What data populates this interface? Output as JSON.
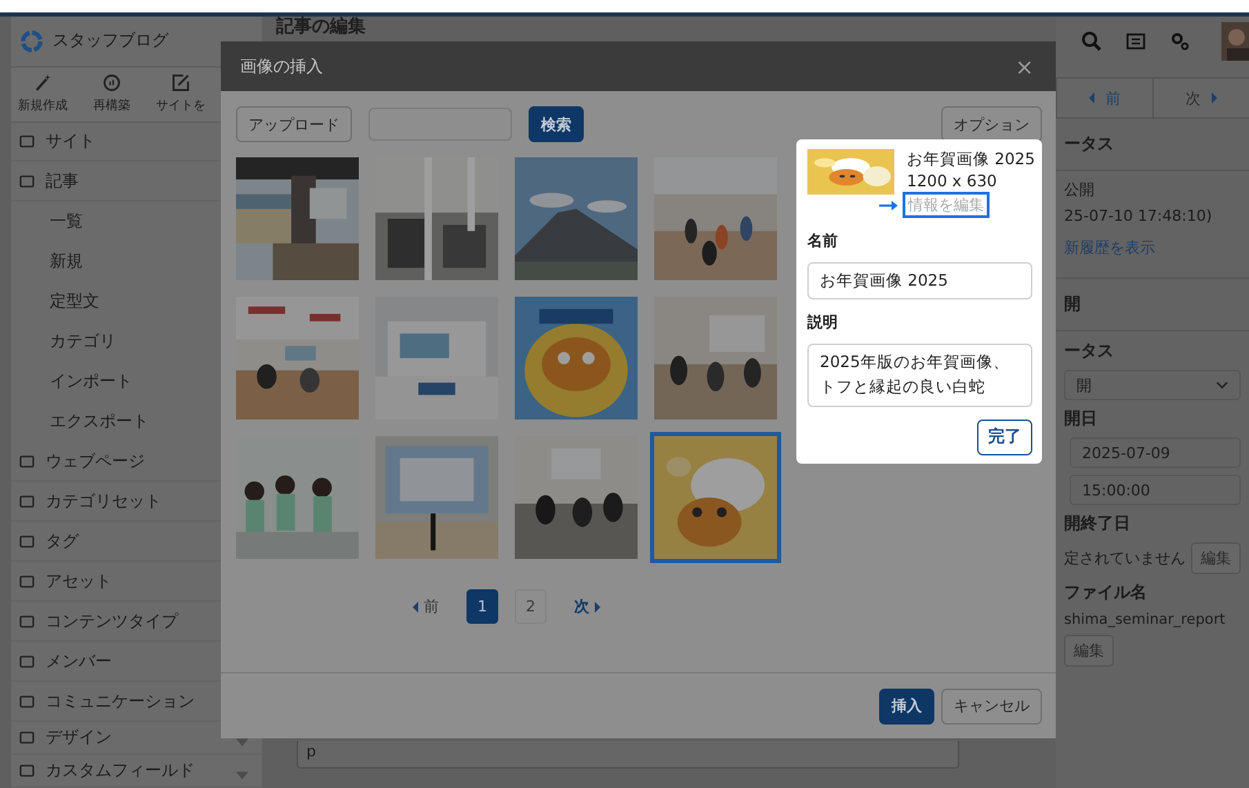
{
  "header_bar": {
    "page_title": "記事の編集"
  },
  "sidebar": {
    "site_name": "スタッフブログ",
    "toolbar": [
      {
        "label": "新規作成"
      },
      {
        "label": "再構築"
      },
      {
        "label": "サイトを"
      }
    ],
    "items": [
      {
        "label": "サイト"
      },
      {
        "label": "記事",
        "children": [
          {
            "label": "一覧"
          },
          {
            "label": "新規"
          },
          {
            "label": "定型文"
          },
          {
            "label": "カテゴリ"
          },
          {
            "label": "インポート"
          },
          {
            "label": "エクスポート"
          }
        ]
      },
      {
        "label": "ウェブページ"
      },
      {
        "label": "カテゴリセット"
      },
      {
        "label": "タグ"
      },
      {
        "label": "アセット"
      },
      {
        "label": "コンテンツタイプ"
      },
      {
        "label": "メンバー"
      },
      {
        "label": "コミュニケーション"
      },
      {
        "label": "デザイン",
        "dropdown": true
      },
      {
        "label": "カスタムフィールド",
        "dropdown": true
      }
    ]
  },
  "editor": {
    "format_field": "p"
  },
  "right_panel": {
    "pager": [
      {
        "label": "前"
      },
      {
        "label": "次"
      }
    ],
    "status_heading": "ータス",
    "status": "公開",
    "updated": "25-07-10 17:48:10)",
    "history_link": "新履歴を表示",
    "section_heading": "開",
    "status_select_heading": "ータス",
    "status_select": "開",
    "publish_date_label": "開日",
    "date": "2025-07-09",
    "time": "15:00:00",
    "end_date_label": "開終了日",
    "end_date_value": "定されていません",
    "end_edit_button": "編集",
    "filename_label": "ファイル名",
    "filename": "shima_seminar_report",
    "filename_edit_button": "編集"
  },
  "modal": {
    "title": "画像の挿入",
    "close": "×",
    "upload_button": "アップロード",
    "search_button": "検索",
    "options_button": "オプション",
    "images": [
      {
        "kind": "picture",
        "selected": false
      },
      {
        "kind": "picture",
        "selected": false
      },
      {
        "kind": "picture",
        "selected": false
      },
      {
        "kind": "picture",
        "selected": false
      },
      {
        "kind": "picture",
        "selected": false
      },
      {
        "kind": "picture",
        "selected": false
      },
      {
        "kind": "picture",
        "selected": false
      },
      {
        "kind": "picture",
        "selected": false
      },
      {
        "kind": "picture",
        "selected": false
      },
      {
        "kind": "picture",
        "selected": false
      },
      {
        "kind": "picture",
        "selected": false
      },
      {
        "kind": "picture",
        "selected": true
      }
    ],
    "pagination": {
      "prev": "前",
      "pages": [
        {
          "label": "1",
          "selected": true
        },
        {
          "label": "2",
          "selected": false
        }
      ],
      "next": "次"
    },
    "insert_button": "挿入",
    "cancel_button": "キャンセル"
  },
  "image_details": {
    "title": "お年賀画像 2025",
    "size": "1200 x 630",
    "edit_link": "情報を編集",
    "edit_link_focused": true,
    "name_label": "名前",
    "name_value": "お年賀画像 2025",
    "description_label": "説明",
    "description_value": "2025年版のお年賀画像、トフと縁起の良い白蛇",
    "done_button": "完了"
  }
}
